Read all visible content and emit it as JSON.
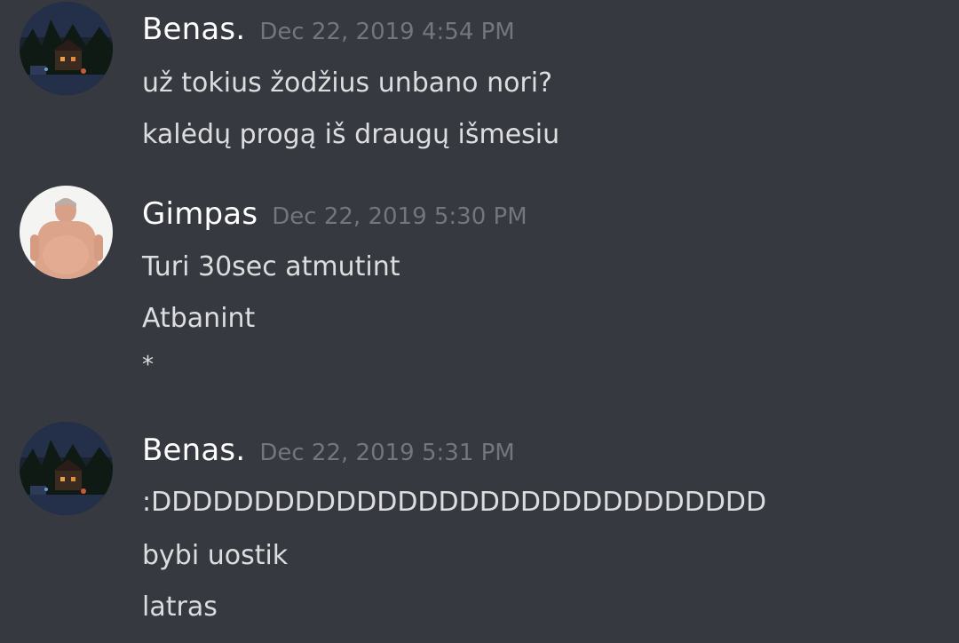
{
  "messages": [
    {
      "username": "Benas.",
      "timestamp": "Dec 22, 2019 4:54 PM",
      "avatar_icon": "night-town-avatar",
      "lines": [
        "už tokius žodžius unbano nori?",
        "kalėdų progą iš draugų išmesiu"
      ]
    },
    {
      "username": "Gimpas",
      "timestamp": "Dec 22, 2019 5:30 PM",
      "avatar_icon": "man-photo-avatar",
      "lines": [
        "Turi 30sec atmutint",
        "Atbanint",
        "*"
      ]
    },
    {
      "username": "Benas.",
      "timestamp": "Dec 22, 2019 5:31 PM",
      "avatar_icon": "night-town-avatar",
      "lines": [
        ":DDDDDDDDDDDDDDDDDDDDDDDDDDDDDD",
        "bybi uostik",
        "latras"
      ]
    }
  ],
  "colors": {
    "background": "#36393f",
    "username": "#ffffff",
    "timestamp": "#72767d",
    "text": "#dcddde"
  }
}
